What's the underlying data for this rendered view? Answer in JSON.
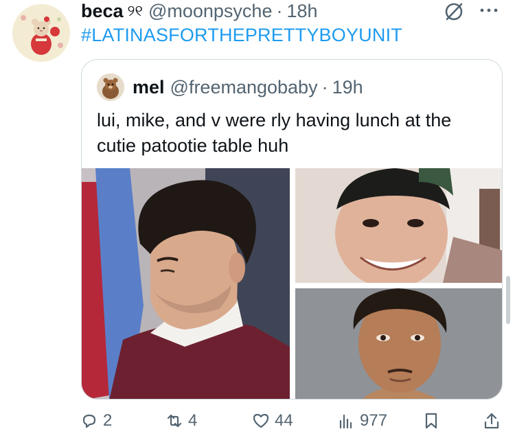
{
  "tweet": {
    "author_name": "beca",
    "author_emoji": "୨୧",
    "author_handle": "@moonpsyche",
    "separator": "·",
    "time": "18h",
    "text": "#LATINASFORTHEPRETTYBOYUNIT"
  },
  "quote": {
    "author_name": "mel",
    "author_handle": "@freemangobaby",
    "separator": "·",
    "time": "19h",
    "text": "lui, mike, and v were rly having lunch at the cutie patootie table huh"
  },
  "actions": {
    "replies": "2",
    "retweets": "4",
    "likes": "44",
    "views": "977"
  },
  "colors": {
    "link": "#1d9bf0",
    "secondary_text": "#536471",
    "border": "#cfd9de"
  },
  "icons": [
    "grok-icon",
    "more-icon",
    "reply-icon",
    "retweet-icon",
    "like-icon",
    "views-icon",
    "bookmark-icon",
    "share-icon"
  ]
}
